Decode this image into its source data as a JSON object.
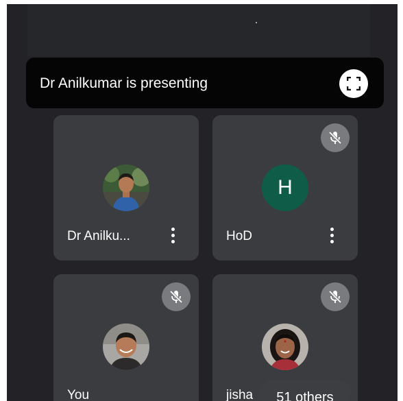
{
  "presentation": {
    "banner_text": "Dr Anilkumar is presenting",
    "fullscreen_icon": "fullscreen-icon"
  },
  "participants": [
    {
      "name": "Dr Anilku...",
      "avatar": "photo",
      "muted": false,
      "has_menu": true
    },
    {
      "name": "HoD",
      "avatar_letter": "H",
      "avatar_color": "#0f5c49",
      "muted": true,
      "has_menu": true
    },
    {
      "name": "You",
      "avatar": "photo",
      "muted": true,
      "has_menu": false
    },
    {
      "name": "jisha",
      "avatar": "photo",
      "muted": true,
      "has_menu": false
    }
  ],
  "others_chip": {
    "label": "51 others"
  },
  "colors": {
    "background": "#232327",
    "tile": "#3b3c40",
    "banner": "#050505",
    "mute_badge": "#7a7b7f"
  }
}
